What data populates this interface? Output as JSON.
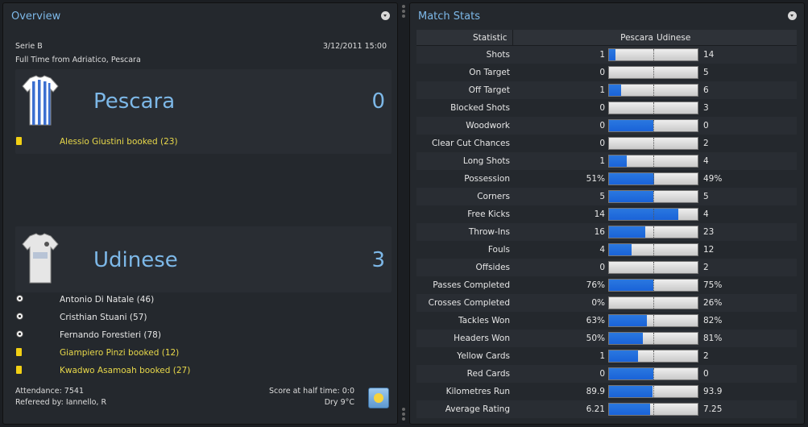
{
  "overview": {
    "title": "Overview",
    "competition": "Serie B",
    "datetime": "3/12/2011 15:00",
    "venue_line": "Full Time from Adriatico, Pescara",
    "home": {
      "name": "Pescara",
      "score": "0",
      "kit_colors": [
        "#ffffff",
        "#3b6fd0"
      ],
      "events": [
        {
          "type": "booking",
          "icon": "yellow-card-icon",
          "text": "Alessio Giustini booked (23)"
        }
      ]
    },
    "away": {
      "name": "Udinese",
      "score": "3",
      "kit_colors": [
        "#e6e6e6",
        "#b0b0b0"
      ],
      "events": [
        {
          "type": "goal",
          "icon": "ball-icon",
          "text": "Antonio Di Natale (46)"
        },
        {
          "type": "goal",
          "icon": "ball-icon",
          "text": "Cristhian Stuani (57)"
        },
        {
          "type": "goal",
          "icon": "ball-icon",
          "text": "Fernando Forestieri (78)"
        },
        {
          "type": "booking",
          "icon": "yellow-card-icon",
          "text": "Giampiero Pinzi booked (12)"
        },
        {
          "type": "booking",
          "icon": "yellow-card-icon",
          "text": "Kwadwo Asamoah booked (27)"
        }
      ]
    },
    "attendance": "Attendance: 7541",
    "referee": "Refereed by: Iannello, R",
    "halftime": "Score at half time: 0:0",
    "weather": "Dry 9°C",
    "weather_icon": "sun-icon"
  },
  "stats": {
    "title": "Match Stats",
    "header_statistic": "Statistic",
    "header_home": "Pescara",
    "header_away": "Udinese",
    "accent_color": "#1a63d8",
    "rows": [
      {
        "label": "Shots",
        "home": "1",
        "away": "14",
        "home_share": 0.07
      },
      {
        "label": "On Target",
        "home": "0",
        "away": "5",
        "home_share": 0.0
      },
      {
        "label": "Off Target",
        "home": "1",
        "away": "6",
        "home_share": 0.14
      },
      {
        "label": "Blocked Shots",
        "home": "0",
        "away": "3",
        "home_share": 0.0
      },
      {
        "label": "Woodwork",
        "home": "0",
        "away": "0",
        "home_share": 0.5
      },
      {
        "label": "Clear Cut Chances",
        "home": "0",
        "away": "2",
        "home_share": 0.0
      },
      {
        "label": "Long Shots",
        "home": "1",
        "away": "4",
        "home_share": 0.2
      },
      {
        "label": "Possession",
        "home": "51%",
        "away": "49%",
        "home_share": 0.51
      },
      {
        "label": "Corners",
        "home": "5",
        "away": "5",
        "home_share": 0.5
      },
      {
        "label": "Free Kicks",
        "home": "14",
        "away": "4",
        "home_share": 0.78
      },
      {
        "label": "Throw-Ins",
        "home": "16",
        "away": "23",
        "home_share": 0.41
      },
      {
        "label": "Fouls",
        "home": "4",
        "away": "12",
        "home_share": 0.25
      },
      {
        "label": "Offsides",
        "home": "0",
        "away": "2",
        "home_share": 0.0
      },
      {
        "label": "Passes Completed",
        "home": "76%",
        "away": "75%",
        "home_share": 0.5
      },
      {
        "label": "Crosses Completed",
        "home": "0%",
        "away": "26%",
        "home_share": 0.0
      },
      {
        "label": "Tackles Won",
        "home": "63%",
        "away": "82%",
        "home_share": 0.43
      },
      {
        "label": "Headers Won",
        "home": "50%",
        "away": "81%",
        "home_share": 0.38
      },
      {
        "label": "Yellow Cards",
        "home": "1",
        "away": "2",
        "home_share": 0.33
      },
      {
        "label": "Red Cards",
        "home": "0",
        "away": "0",
        "home_share": 0.5
      },
      {
        "label": "Kilometres Run",
        "home": "89.9",
        "away": "93.9",
        "home_share": 0.49
      },
      {
        "label": "Average Rating",
        "home": "6.21",
        "away": "7.25",
        "home_share": 0.46
      }
    ]
  }
}
